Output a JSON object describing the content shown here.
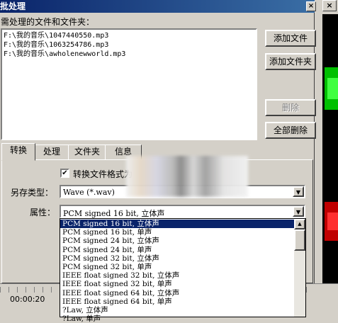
{
  "window": {
    "title": "批处理",
    "close_glyph": "×"
  },
  "background_app": {
    "close_glyph": "×"
  },
  "files": {
    "label": "需处理的文件和文件夹：",
    "items": [
      "F:\\我的音乐\\1047440550.mp3",
      "F:\\我的音乐\\1063254786.mp3",
      "F:\\我的音乐\\awholenewworld.mp3"
    ]
  },
  "buttons": {
    "add_file": "添加文件",
    "add_folder": "添加文件夹",
    "delete": "删除",
    "delete_all": "全部删除"
  },
  "tabs": [
    "转换",
    "处理",
    "文件夹",
    "信息"
  ],
  "convert": {
    "checkbox_label": "转换文件格式为",
    "checkbox_checked": true,
    "save_type_label": "另存类型：",
    "save_type_value": "Wave (*.wav)",
    "attr_label": "属性：",
    "attr_value": "PCM signed 16 bit, 立体声"
  },
  "dropdown_options": [
    "PCM signed 16 bit, 立体声",
    "PCM signed 16 bit, 单声",
    "PCM signed 24 bit, 立体声",
    "PCM signed 24 bit, 单声",
    "PCM signed 32 bit, 立体声",
    "PCM signed 32 bit, 单声",
    "IEEE float signed 32 bit, 立体声",
    "IEEE float signed 32 bit, 单声",
    "IEEE float signed 64 bit, 立体声",
    "IEEE float signed 64 bit, 单声",
    "?Law, 立体声",
    "?Law, 单声"
  ],
  "selected_option_index": 0,
  "timeline": {
    "time_label": "00:00:20"
  }
}
